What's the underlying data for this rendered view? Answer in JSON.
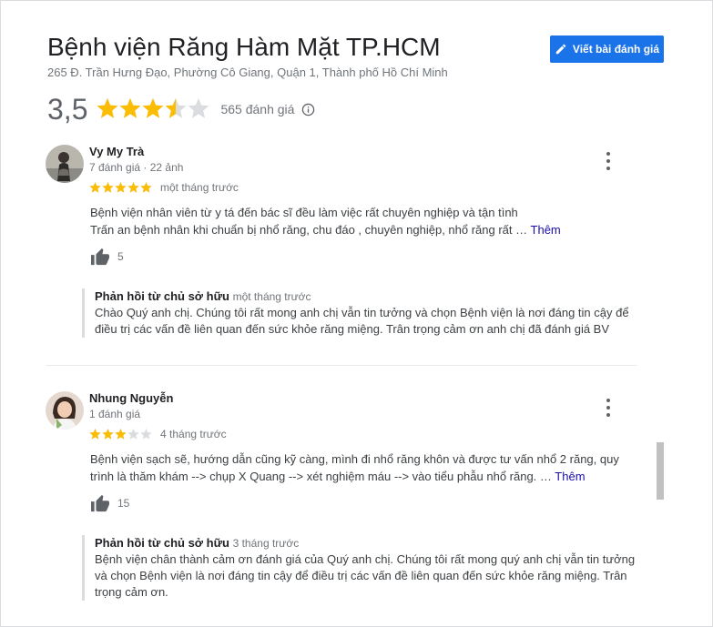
{
  "place": {
    "name": "Bệnh viện Răng Hàm Mặt TP.HCM",
    "address": "265 Đ. Trần Hưng Đạo, Phường Cô Giang, Quận 1, Thành phố Hồ Chí Minh",
    "write_review_label": "Viết bài đánh giá",
    "rating": "3,5",
    "rating_value": 3.5,
    "review_count": "565 đánh giá",
    "star_color": "#fbbc04",
    "empty_star_color": "#dadce0",
    "accent": "#1a73e8"
  },
  "reviews": [
    {
      "author": "Vy My Trà",
      "meta": "7 đánh giá · 22 ảnh",
      "stars": 5,
      "time": "một tháng trước",
      "text_lines": [
        "Bệnh viện nhân viên từ y tá đến bác sĩ đều làm việc rất chuyên nghiệp và tận tình",
        "Trấn an bệnh nhân khi chuẩn bị nhổ răng, chu đáo , chuyên nghiệp, nhổ răng rất …"
      ],
      "more_label": "Thêm",
      "likes": "5",
      "reply": {
        "label": "Phản hồi từ chủ sở hữu",
        "time": "một tháng trước",
        "text": "Chào Quý anh chị. Chúng tôi rất mong anh chị vẫn tin tưởng và chọn Bệnh viện là nơi đáng tin cậy để điều trị các vấn đề liên quan đến sức khỏe răng miệng. Trân trọng cảm ơn anh chị đã đánh giá BV"
      }
    },
    {
      "author": "Nhung Nguyễn",
      "meta": "1 đánh giá",
      "stars": 3,
      "time": "4 tháng trước",
      "text_lines": [
        "Bệnh viện sạch sẽ, hướng dẫn cũng kỹ càng, mình đi nhổ răng khôn và được tư vấn nhổ 2 răng, quy",
        "trình là thăm khám --> chụp X Quang --> xét nghiệm máu --> vào tiểu phẫu nhổ răng. …"
      ],
      "more_label": "Thêm",
      "likes": "15",
      "reply": {
        "label": "Phản hồi từ chủ sở hữu",
        "time": "3 tháng trước",
        "text": "Bệnh viện chân thành cảm ơn đánh giá của Quý anh chị. Chúng tôi rất mong quý anh chị vẫn tin tưởng và chọn Bệnh viện là nơi đáng tin cậy để điều trị các vấn đề liên quan đến sức khỏe răng miệng. Trân trọng cảm ơn."
      }
    }
  ]
}
